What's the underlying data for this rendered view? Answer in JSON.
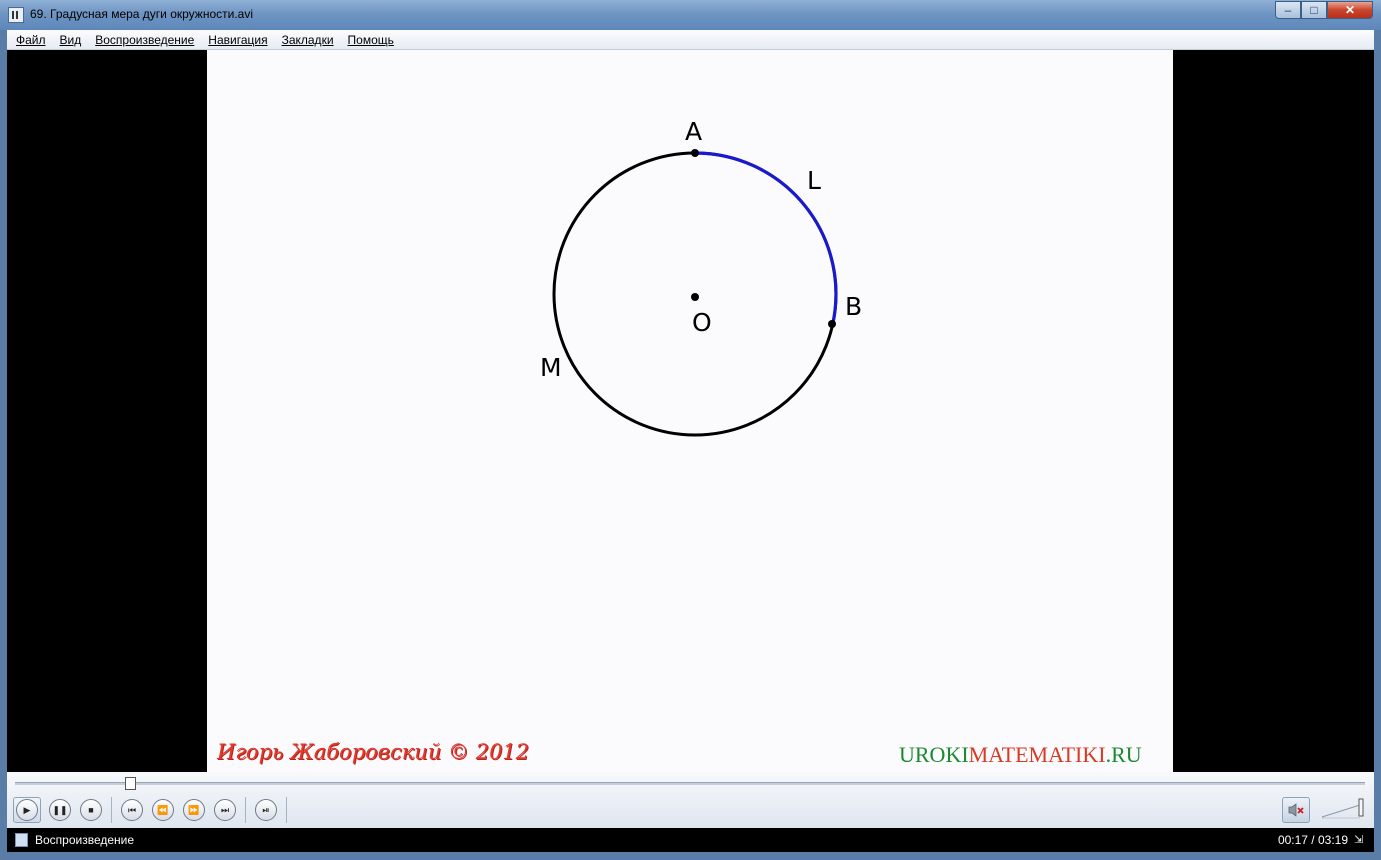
{
  "window": {
    "title": "69. Градусная мера дуги окружности.avi",
    "minimize_glyph": "–",
    "maximize_glyph": "□",
    "close_glyph": "✕"
  },
  "menu": {
    "items": [
      {
        "label": "Файл"
      },
      {
        "label": "Вид"
      },
      {
        "label": "Воспроизведение"
      },
      {
        "label": "Навигация"
      },
      {
        "label": "Закладки"
      },
      {
        "label": "Помощь"
      }
    ]
  },
  "video": {
    "diagram": {
      "labels": {
        "A": "A",
        "L": "L",
        "B": "B",
        "O": "O",
        "M": "M"
      },
      "circle_color": "#000000",
      "arc_color": "#1a1acc"
    },
    "credit_author": "Игорь Жаборовский © 2012",
    "credit_site_part1": "UROKI",
    "credit_site_part2": "MATEMATIKI",
    "credit_site_part3": ".RU",
    "colors": {
      "author": "#e03a28",
      "site_green": "#1b8a2f",
      "site_red": "#d93a24"
    }
  },
  "controls": {
    "seek_fraction": 0.0854,
    "buttons": [
      {
        "name": "play",
        "glyph": "▶"
      },
      {
        "name": "pause",
        "glyph": "❚❚"
      },
      {
        "name": "stop",
        "glyph": "■"
      },
      {
        "name": "previous",
        "glyph": "⏮"
      },
      {
        "name": "rewind",
        "glyph": "⏪"
      },
      {
        "name": "fast-forward",
        "glyph": "⏩"
      },
      {
        "name": "next",
        "glyph": "⏭"
      },
      {
        "name": "frame-step",
        "glyph": "⏯"
      }
    ]
  },
  "status": {
    "text": "Воспроизведение",
    "time": "00:17 / 03:19"
  }
}
